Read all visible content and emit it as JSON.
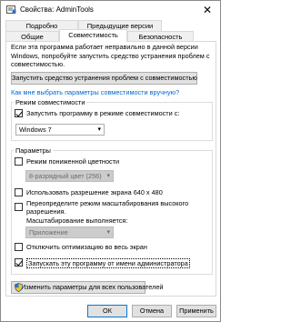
{
  "window": {
    "title": "Свойства: AdminTools",
    "close_glyph": "✕"
  },
  "tabs": {
    "row1": [
      "Подробно",
      "Предыдущие версии"
    ],
    "row2": [
      "Общие",
      "Совместимость",
      "Безопасность"
    ],
    "active": "Совместимость"
  },
  "intro": "Если эта программа работает неправильно в данной версии Windows, попробуйте запустить средство устранения проблем с совместимостью.",
  "troubleshooter_button": "Запустить средство устранения проблем с совместимостью",
  "manual_link": "Как мне выбрать параметры совместимости вручную?",
  "compat_mode": {
    "group_title": "Режим совместимости",
    "checkbox_label": "Запустить программу в режиме совместимости с:",
    "checked": true,
    "selected_os": "Windows 7"
  },
  "settings": {
    "group_title": "Параметры",
    "reduced_color": {
      "label": "Режим пониженной цветности",
      "checked": false
    },
    "color_combo": "8-разрядный цвет (256)",
    "res_640": {
      "label": "Использовать разрешение экрана 640 x 480",
      "checked": false
    },
    "dpi_override": {
      "label_line1": "Переопределите режим масштабирования высокого",
      "label_line2": "разрешения.",
      "label_line3": "Масштабирование выполняется:",
      "checked": false
    },
    "dpi_combo": "Приложение",
    "fullscreen_opt": {
      "label": "Отключить оптимизацию во весь экран",
      "checked": false
    },
    "run_as_admin": {
      "label": "Запускать эту программу от имени администратора",
      "checked": true
    }
  },
  "all_users_button": "Изменить параметры для всех пользователей",
  "footer": {
    "ok": "ОК",
    "cancel": "Отмена",
    "apply": "Применить"
  },
  "colors": {
    "link": "#0066cc",
    "focus": "#0078d7"
  }
}
